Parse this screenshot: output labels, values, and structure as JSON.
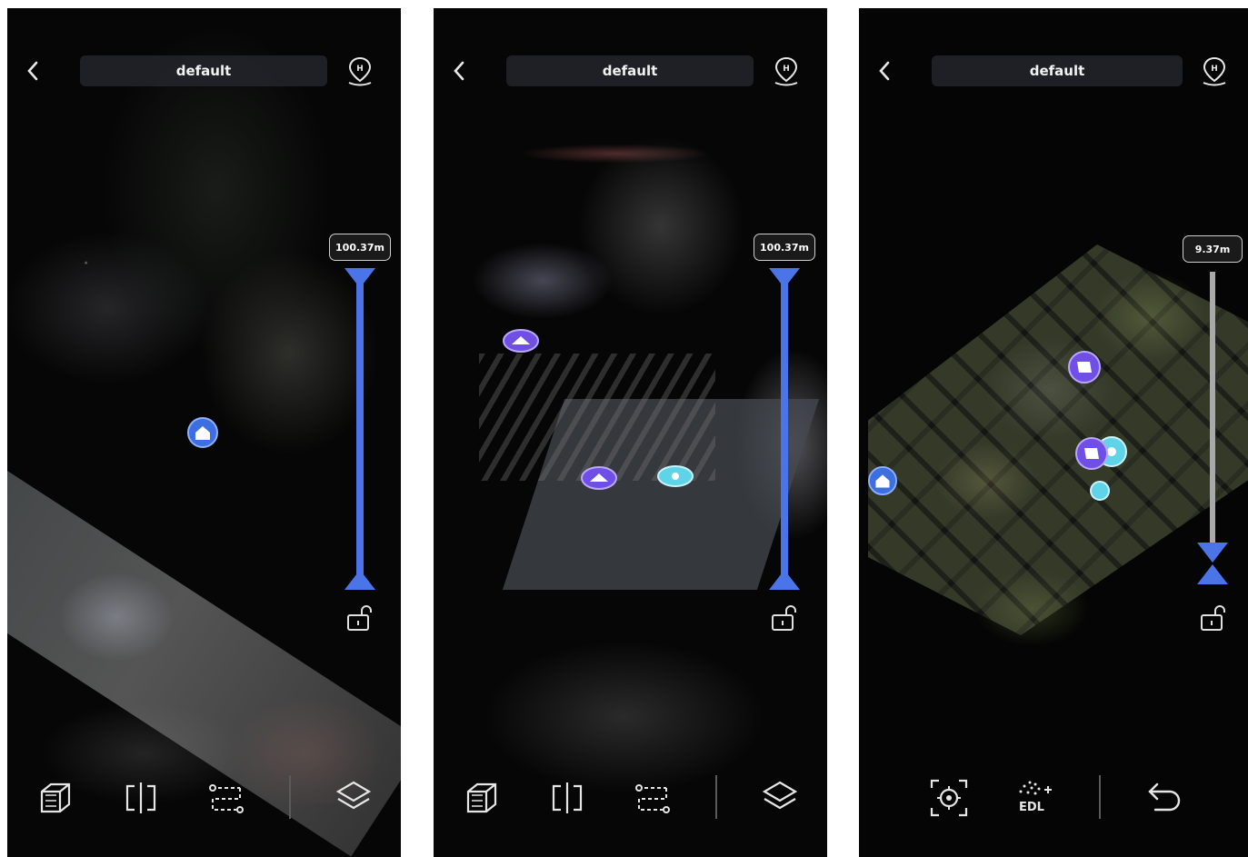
{
  "screens": [
    {
      "title": "default",
      "height_readout": "100.37m",
      "toolbar": [
        "cube-icon",
        "split-view-icon",
        "path-icon",
        "layers-icon"
      ]
    },
    {
      "title": "default",
      "height_readout": "100.37m",
      "toolbar": [
        "cube-icon",
        "split-view-icon",
        "path-icon",
        "layers-icon"
      ]
    },
    {
      "title": "default",
      "height_readout": "9.37m",
      "toolbar": [
        "target-icon",
        "edl-icon",
        "undo-icon"
      ],
      "edl_label": "EDL"
    }
  ],
  "colors": {
    "slider_active": "#4a74e8",
    "slider_inactive": "#a9a9a9",
    "marker_purple": "#6f4fe6",
    "marker_blue": "#3e6fe0",
    "marker_cyan": "#5fd3e8"
  }
}
